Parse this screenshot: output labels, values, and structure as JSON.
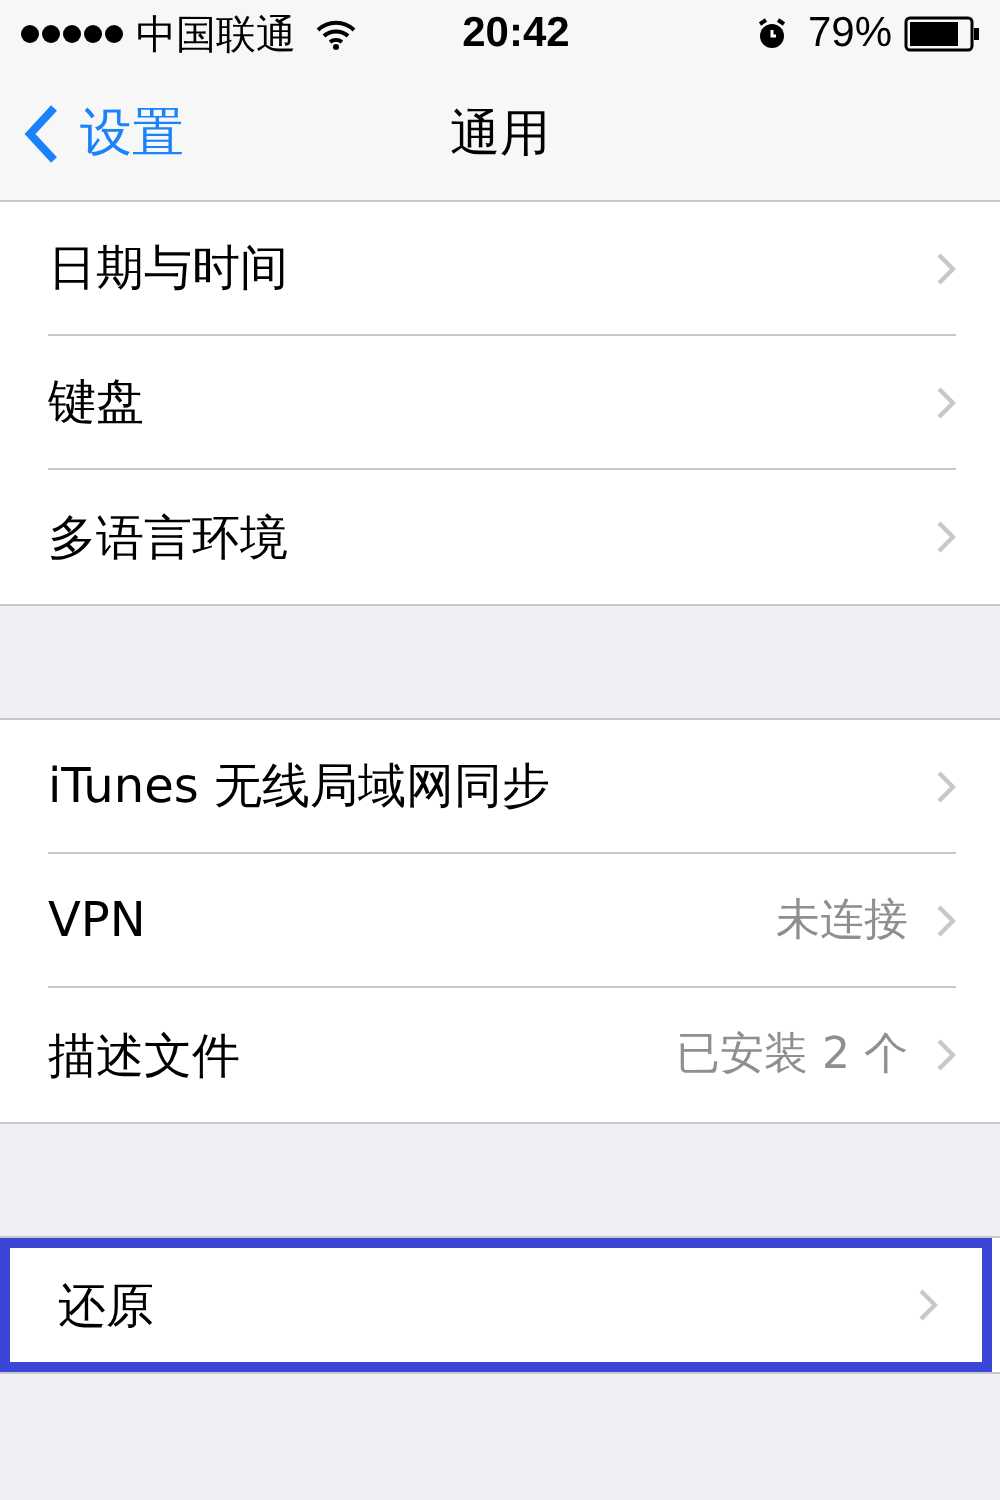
{
  "status_bar": {
    "carrier": "中国联通",
    "time": "20:42",
    "battery": "79%"
  },
  "nav": {
    "back": "设置",
    "title": "通用"
  },
  "groups": [
    {
      "rows": [
        {
          "label": "日期与时间",
          "highlighted": false
        },
        {
          "label": "键盘",
          "highlighted": false
        },
        {
          "label": "多语言环境",
          "highlighted": false
        }
      ]
    },
    {
      "rows": [
        {
          "label": "iTunes 无线局域网同步",
          "highlighted": false
        },
        {
          "label": "VPN",
          "value": "未连接",
          "highlighted": false
        },
        {
          "label": "描述文件",
          "value": "已安装 2 个",
          "highlighted": false
        }
      ]
    },
    {
      "rows": [
        {
          "label": "还原",
          "highlighted": true
        }
      ]
    }
  ]
}
